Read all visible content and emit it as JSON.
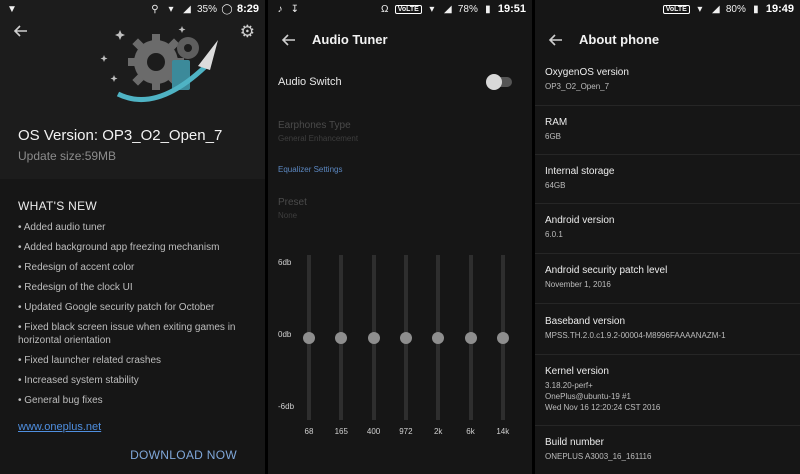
{
  "colors": {
    "background": "#161616",
    "header_bg": "#1c1c1c",
    "accent": "#5b87c0",
    "link": "#4f8fe0"
  },
  "icons": [
    "back-arrow-icon",
    "gear-icon",
    "wifi-icon",
    "battery-icon",
    "music-note-icon",
    "headphones-icon",
    "rocket-icon"
  ],
  "ota": {
    "status": {
      "battery": "35%",
      "time": "8:29"
    },
    "os_version": "OS Version: OP3_O2_Open_7",
    "update_size": "Update size:59MB",
    "whats_new_title": "WHAT'S NEW",
    "notes": [
      "• Added audio tuner",
      "• Added background app freezing mechanism",
      "• Redesign of accent color",
      "• Redesign of the clock UI",
      "• Updated Google security patch for October",
      "• Fixed black screen issue when exiting games in horizontal orientation",
      "• Fixed launcher related crashes",
      "• Increased system stability",
      "• General bug fixes"
    ],
    "link": "www.oneplus.net",
    "download": "DOWNLOAD NOW"
  },
  "audio": {
    "status": {
      "battery": "78%",
      "time": "19:51",
      "volte": "VoLTE"
    },
    "title": "Audio Tuner",
    "switch_label": "Audio Switch",
    "switch_on": false,
    "earphones_title": "Earphones Type",
    "earphones_value": "General Enhancement",
    "equalizer_heading": "Equalizer Settings",
    "preset_title": "Preset",
    "preset_value": "None",
    "db_labels": {
      "top": "6db",
      "mid": "0db",
      "bottom": "-6db"
    },
    "bands": [
      {
        "freq": "68",
        "gain_db": 0
      },
      {
        "freq": "165",
        "gain_db": 0
      },
      {
        "freq": "400",
        "gain_db": 0
      },
      {
        "freq": "972",
        "gain_db": 0
      },
      {
        "freq": "2k",
        "gain_db": 0
      },
      {
        "freq": "6k",
        "gain_db": 0
      },
      {
        "freq": "14k",
        "gain_db": 0
      }
    ]
  },
  "about": {
    "status": {
      "battery": "80%",
      "time": "19:49",
      "volte": "VoLTE"
    },
    "title": "About phone",
    "items": [
      {
        "title": "OxygenOS version",
        "value": "OP3_O2_Open_7"
      },
      {
        "title": "RAM",
        "value": "6GB"
      },
      {
        "title": "Internal storage",
        "value": "64GB"
      },
      {
        "title": "Android version",
        "value": "6.0.1"
      },
      {
        "title": "Android security patch level",
        "value": "November 1, 2016"
      },
      {
        "title": "Baseband version",
        "value": "MPSS.TH.2.0.c1.9.2-00004-M8996FAAAANAZM-1"
      },
      {
        "title": "Kernel version",
        "value": "3.18.20-perf+\nOnePlus@ubuntu-19 #1\nWed Nov 16 12:20:24 CST 2016"
      },
      {
        "title": "Build number",
        "value": "ONEPLUS A3003_16_161116"
      }
    ]
  }
}
